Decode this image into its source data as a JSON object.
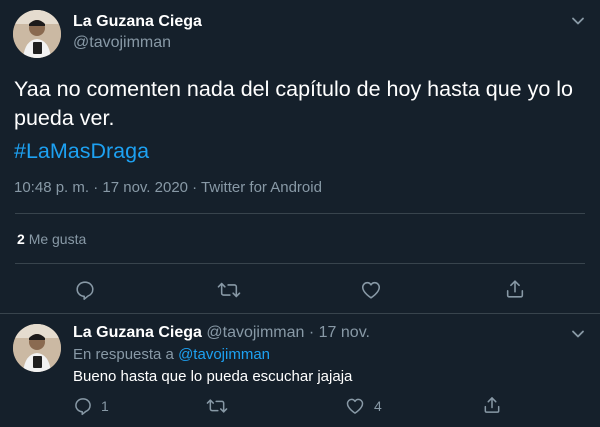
{
  "main_tweet": {
    "author_name": "La Guzana Ciega",
    "author_handle": "@tavojimman",
    "text": "Yaa no comenten nada del capítulo de hoy hasta que yo lo pueda ver.",
    "hashtag": "#LaMasDraga",
    "timestamp": "10:48 p. m. · 17 nov. 2020 · Twitter for Android",
    "likes_count": "2",
    "likes_label": "Me gusta"
  },
  "reply_tweet": {
    "author_name": "La Guzana Ciega",
    "author_handle": "@tavojimman",
    "separator": "·",
    "date": "17 nov.",
    "replying_prefix": "En respuesta a",
    "replying_to": "@tavojimman",
    "text": "Bueno hasta que lo pueda escuchar jajaja",
    "reply_count": "1",
    "like_count": "4"
  },
  "icons": {
    "reply": "reply-icon",
    "retweet": "retweet-icon",
    "like": "heart-icon",
    "share": "share-icon",
    "more": "chevron-down-icon"
  },
  "colors": {
    "background": "#15202b",
    "text": "#ffffff",
    "muted": "#8899a6",
    "link": "#1da1f2",
    "divider": "#38444d"
  }
}
